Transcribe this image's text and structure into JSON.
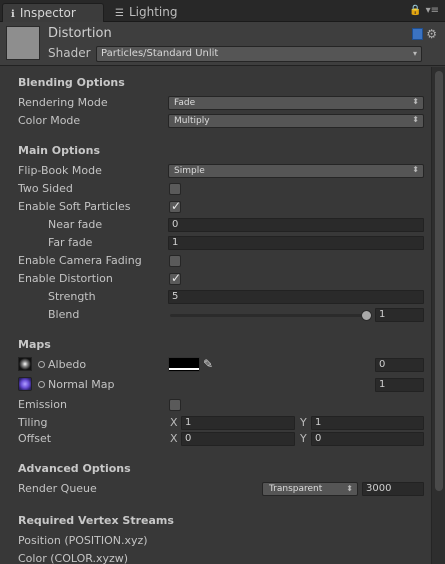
{
  "tabs": {
    "inspector": "Inspector",
    "lighting": "Lighting"
  },
  "material": {
    "name": "Distortion",
    "shader_label": "Shader",
    "shader_value": "Particles/Standard Unlit"
  },
  "sections": {
    "blending": "Blending Options",
    "main": "Main Options",
    "maps": "Maps",
    "advanced": "Advanced Options",
    "vertex_streams": "Required Vertex Streams"
  },
  "blending": {
    "rendering_mode_label": "Rendering Mode",
    "rendering_mode_value": "Fade",
    "color_mode_label": "Color Mode",
    "color_mode_value": "Multiply"
  },
  "main": {
    "flipbook_label": "Flip-Book Mode",
    "flipbook_value": "Simple",
    "two_sided_label": "Two Sided",
    "two_sided": false,
    "soft_particles_label": "Enable Soft Particles",
    "soft_particles": true,
    "near_fade_label": "Near fade",
    "near_fade_value": "0",
    "far_fade_label": "Far fade",
    "far_fade_value": "1",
    "camera_fading_label": "Enable Camera Fading",
    "camera_fading": false,
    "distortion_label": "Enable Distortion",
    "distortion": true,
    "strength_label": "Strength",
    "strength_value": "5",
    "blend_label": "Blend",
    "blend_value": "1"
  },
  "maps": {
    "albedo_label": "Albedo",
    "albedo_value": "0",
    "normal_label": "Normal Map",
    "normal_value": "1",
    "emission_label": "Emission",
    "emission": false,
    "tiling_label": "Tiling",
    "tiling_x": "1",
    "tiling_y": "1",
    "offset_label": "Offset",
    "offset_x": "0",
    "offset_y": "0",
    "x_label": "X",
    "y_label": "Y"
  },
  "advanced": {
    "render_queue_label": "Render Queue",
    "render_queue_mode": "Transparent",
    "render_queue_value": "3000"
  },
  "vertex_streams": [
    "Position (POSITION.xyz)",
    "Color (COLOR.xyzw)"
  ],
  "colors": {
    "background": "#383838",
    "tabbar": "#282828",
    "field": "#2a2a2a",
    "dropdown": "#555555"
  }
}
